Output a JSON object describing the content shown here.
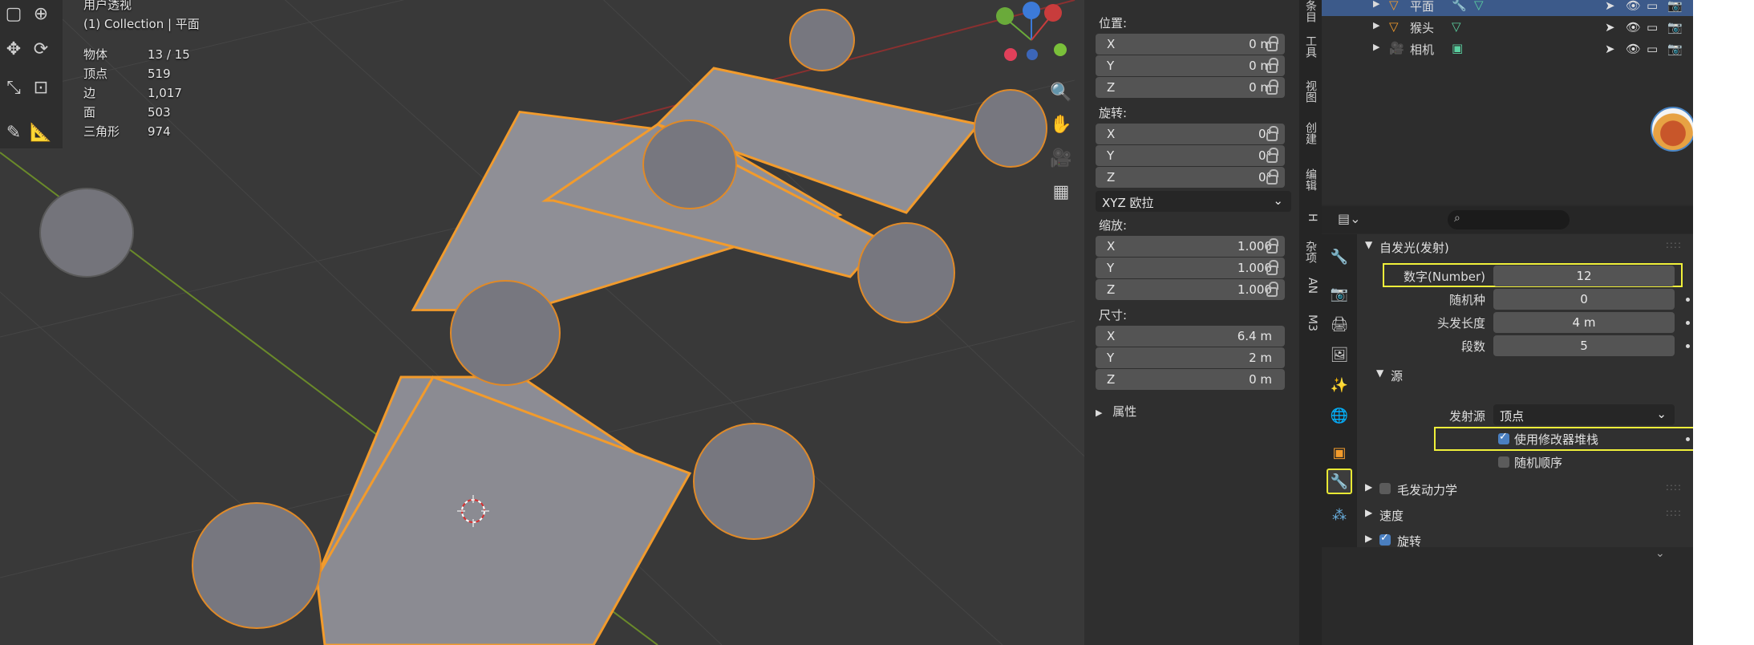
{
  "viewport": {
    "header_line1": "用户透视",
    "header_line2": "(1) Collection | 平面",
    "stats": [
      {
        "label": "物体",
        "value": "13 / 15"
      },
      {
        "label": "顶点",
        "value": "519"
      },
      {
        "label": "边",
        "value": "1,017"
      },
      {
        "label": "面",
        "value": "503"
      },
      {
        "label": "三角形",
        "value": "974"
      }
    ],
    "gizmo": {
      "x": "X",
      "y": "Y",
      "z": "Z"
    }
  },
  "npanel": {
    "location_label": "位置:",
    "location": [
      {
        "axis": "X",
        "value": "0 m"
      },
      {
        "axis": "Y",
        "value": "0 m"
      },
      {
        "axis": "Z",
        "value": "0 m"
      }
    ],
    "rotation_label": "旋转:",
    "rotation": [
      {
        "axis": "X",
        "value": "0°"
      },
      {
        "axis": "Y",
        "value": "0°"
      },
      {
        "axis": "Z",
        "value": "0°"
      }
    ],
    "rotation_mode": "XYZ 欧拉",
    "scale_label": "缩放:",
    "scale": [
      {
        "axis": "X",
        "value": "1.000"
      },
      {
        "axis": "Y",
        "value": "1.000"
      },
      {
        "axis": "Z",
        "value": "1.000"
      }
    ],
    "dimensions_label": "尺寸:",
    "dimensions": [
      {
        "axis": "X",
        "value": "6.4 m"
      },
      {
        "axis": "Y",
        "value": "2 m"
      },
      {
        "axis": "Z",
        "value": "0 m"
      }
    ],
    "properties_label": "属性"
  },
  "vtabs": [
    "条目",
    "工具",
    "视图",
    "创建",
    "编辑",
    "H",
    "杂项",
    "AN",
    "M3"
  ],
  "outliner": {
    "rows": [
      {
        "name": "平面",
        "selected": true
      },
      {
        "name": "猴头",
        "selected": false
      },
      {
        "name": "相机",
        "selected": false
      }
    ]
  },
  "properties": {
    "search_placeholder": "",
    "emission_header": "自发光(发射)",
    "number_label": "数字(Number)",
    "number_value": "12",
    "seed_label": "随机种",
    "seed_value": "0",
    "hair_length_label": "头发长度",
    "hair_length_value": "4 m",
    "segments_label": "段数",
    "segments_value": "5",
    "source_header": "源",
    "emit_from_label": "发射源",
    "emit_from_value": "顶点",
    "use_modifier_stack_label": "使用修改器堆栈",
    "random_order_label": "随机顺序",
    "hair_dynamics_label": "毛发动力学",
    "velocity_label": "速度",
    "rotation_label": "旋转"
  },
  "colors": {
    "highlight": "#f0f03a",
    "selection": "#f29b2c",
    "active_row": "#3c5a8a"
  }
}
